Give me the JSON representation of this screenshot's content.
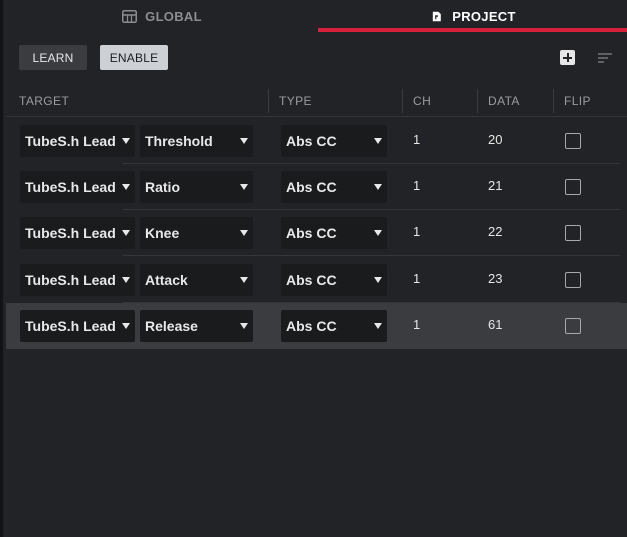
{
  "tabs": {
    "global": {
      "label": "GLOBAL",
      "icon": "grid-icon"
    },
    "project": {
      "label": "PROJECT",
      "icon": "document-icon",
      "accent": "#d7213a"
    }
  },
  "toolbar": {
    "learn_label": "LEARN",
    "enable_label": "ENABLE"
  },
  "columns": [
    "TARGET",
    "TYPE",
    "CH",
    "DATA",
    "FLIP"
  ],
  "rows": [
    {
      "track": "TubeS.h Lead",
      "param": "Threshold",
      "type": "Abs CC",
      "ch": "1",
      "data": "20",
      "flip": false,
      "selected": false
    },
    {
      "track": "TubeS.h Lead",
      "param": "Ratio",
      "type": "Abs CC",
      "ch": "1",
      "data": "21",
      "flip": false,
      "selected": false
    },
    {
      "track": "TubeS.h Lead",
      "param": "Knee",
      "type": "Abs CC",
      "ch": "1",
      "data": "22",
      "flip": false,
      "selected": false
    },
    {
      "track": "TubeS.h Lead",
      "param": "Attack",
      "type": "Abs CC",
      "ch": "1",
      "data": "23",
      "flip": false,
      "selected": false
    },
    {
      "track": "TubeS.h Lead",
      "param": "Release",
      "type": "Abs CC",
      "ch": "1",
      "data": "61",
      "flip": false,
      "selected": true
    }
  ]
}
